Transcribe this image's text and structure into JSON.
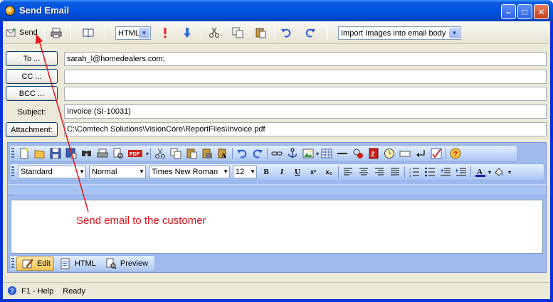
{
  "window": {
    "title": "Send Email",
    "buttons": {
      "minimize": "–",
      "maximize": "□",
      "close": "✕"
    }
  },
  "toolbar": {
    "send_label": "Send",
    "format_value": "HTML",
    "images_value": "Import Images into email body",
    "icons": [
      "send-icon",
      "print-icon",
      "address-book-icon",
      "high-priority-icon",
      "low-priority-icon",
      "cut-icon",
      "copy-icon",
      "paste-icon",
      "undo-icon",
      "redo-icon"
    ]
  },
  "fields": {
    "to_label": "To ...",
    "to_value": "sarah_l@homedealers.com;",
    "cc_label": "CC ...",
    "cc_value": "",
    "bcc_label": "BCC ...",
    "bcc_value": "",
    "subject_label": "Subject:",
    "subject_value": "Invoice (SI-10031)",
    "attachment_label": "Attachment:",
    "attachment_value": "C:\\Comtech Solutions\\VisionCore\\ReportFiles\\Invoice.pdf"
  },
  "editor": {
    "style_value": "Standard",
    "paragraph_value": "Normal",
    "font_value": "Times New Roman",
    "size_value": "12",
    "format_labels": {
      "bold": "B",
      "italic": "I",
      "underline": "U",
      "superscript": "x²",
      "subscript": "x₂"
    },
    "tabs": [
      {
        "label": "Edit"
      },
      {
        "label": "HTML"
      },
      {
        "label": "Preview"
      }
    ]
  },
  "status": {
    "help": "F1 - Help",
    "state": "Ready"
  },
  "annotation": {
    "text": "Send email to the customer",
    "color": "#e8101a"
  },
  "colors": {
    "titlebar": "#0054e3",
    "client": "#ece9d8",
    "editor_toolbar": "#c2d7f7"
  }
}
